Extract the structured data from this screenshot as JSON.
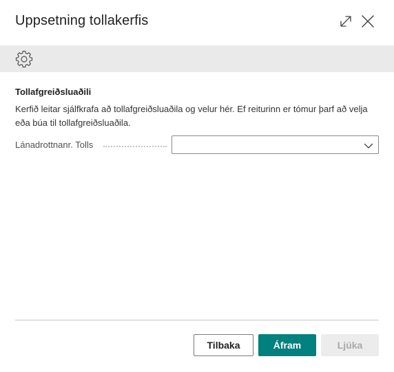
{
  "dialog": {
    "title": "Uppsetning tollakerfis"
  },
  "icons": {
    "expand": "expand-icon",
    "close": "close-icon",
    "settings": "gear-icon",
    "dropdown": "chevron-down-icon"
  },
  "section": {
    "title": "Tollafgreiðsluaðili",
    "description": "Kerfið leitar sjálfkrafa að tollafgreiðsluaðila og velur hér. Ef reiturinn er tómur þarf að velja eða búa til tollafgreiðsluaðila."
  },
  "field": {
    "label": "Lánadrottnanr. Tolls",
    "value": ""
  },
  "buttons": {
    "back": "Tilbaka",
    "next": "Áfram",
    "finish": "Ljúka"
  },
  "colors": {
    "primary": "#00807e",
    "toolbar_bg": "#eaeaea",
    "disabled_bg": "#ececec"
  }
}
